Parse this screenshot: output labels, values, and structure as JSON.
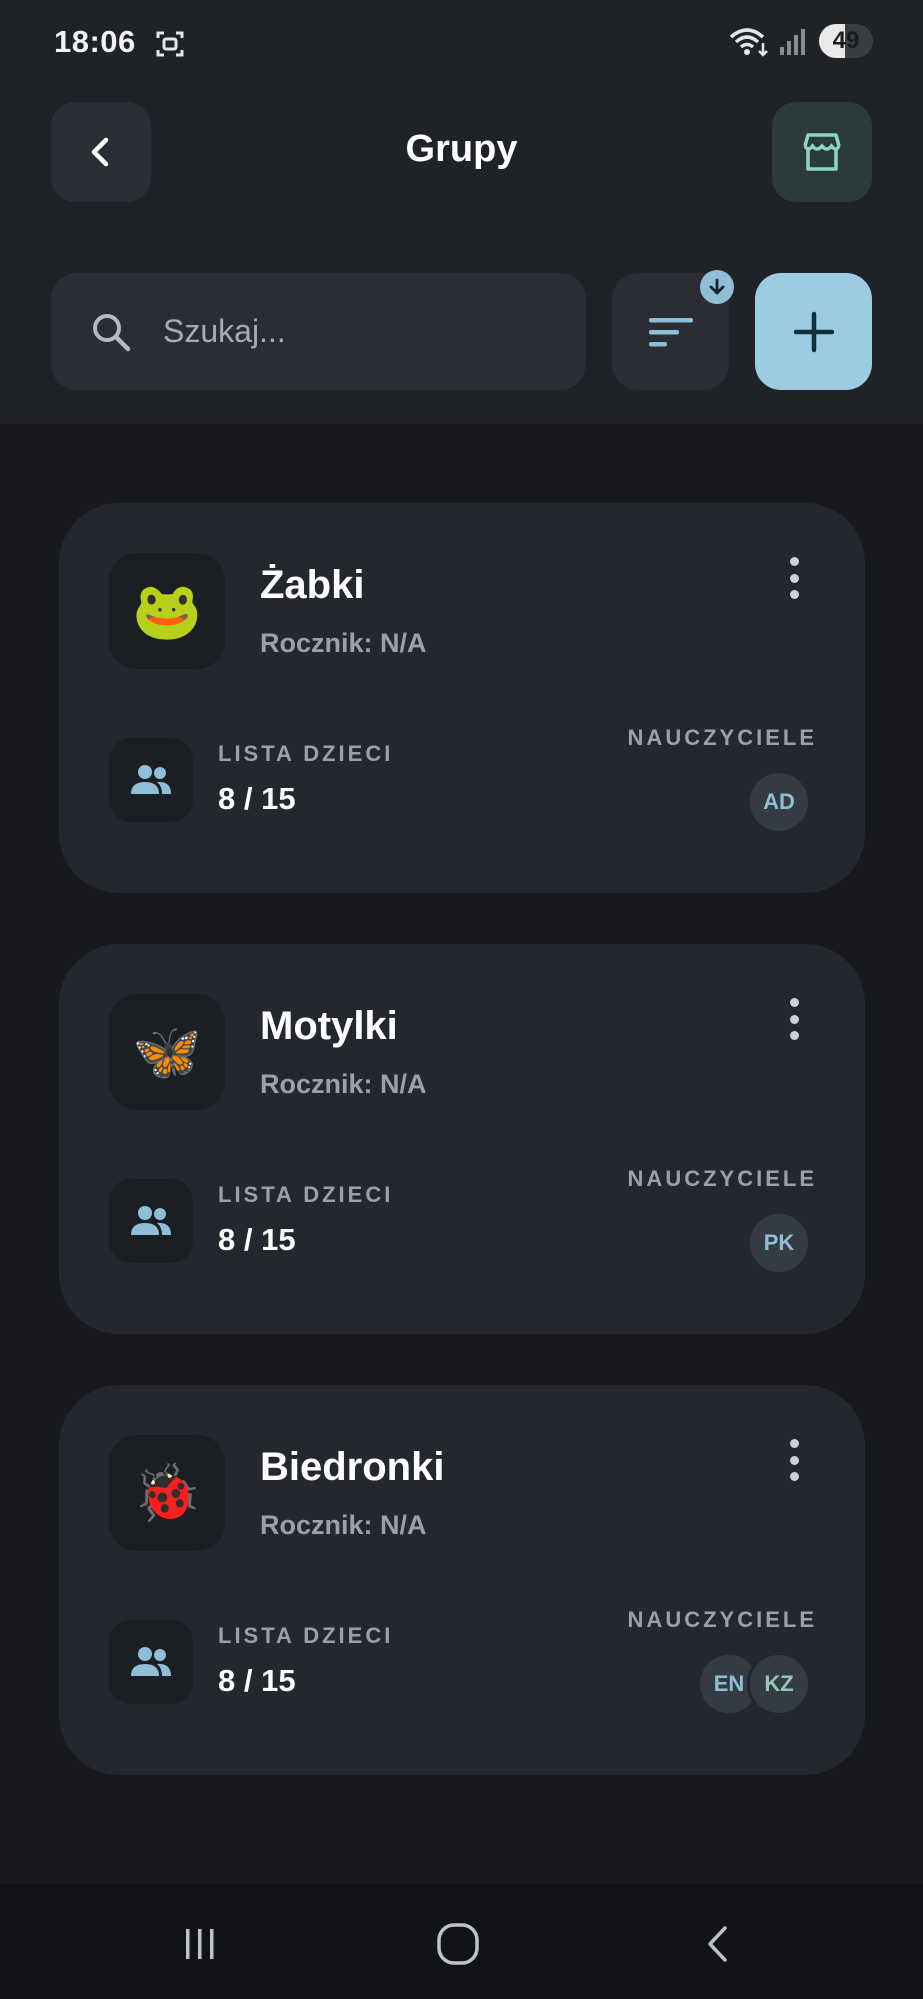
{
  "status_bar": {
    "time": "18:06",
    "battery": "49"
  },
  "header": {
    "title": "Grupy"
  },
  "search": {
    "placeholder": "Szukaj..."
  },
  "colors": {
    "accent": "#9ccce2",
    "card": "#24282e",
    "background": "#17191c"
  },
  "groups": [
    {
      "emoji": "🐸",
      "name": "Żabki",
      "year": "Rocznik: N/A",
      "children_label": "LISTA DZIECI",
      "children_count": "8 / 15",
      "teachers_label": "NAUCZYCIELE",
      "teachers": [
        "AD"
      ]
    },
    {
      "emoji": "🦋",
      "name": "Motylki",
      "year": "Rocznik: N/A",
      "children_label": "LISTA DZIECI",
      "children_count": "8 / 15",
      "teachers_label": "NAUCZYCIELE",
      "teachers": [
        "PK"
      ]
    },
    {
      "emoji": "🐞",
      "name": "Biedronki",
      "year": "Rocznik: N/A",
      "children_label": "LISTA DZIECI",
      "children_count": "8 / 15",
      "teachers_label": "NAUCZYCIELE",
      "teachers": [
        "EN",
        "KZ"
      ]
    }
  ],
  "icons": {
    "back": "chevron-left-icon",
    "store": "store-icon",
    "search": "search-icon",
    "sort": "sort-icon",
    "sort_badge": "arrow-down-icon",
    "add": "plus-icon",
    "menu": "more-vertical-icon",
    "people": "people-icon",
    "nav_recents": "recents-icon",
    "nav_home": "home-icon",
    "nav_back": "back-icon"
  }
}
